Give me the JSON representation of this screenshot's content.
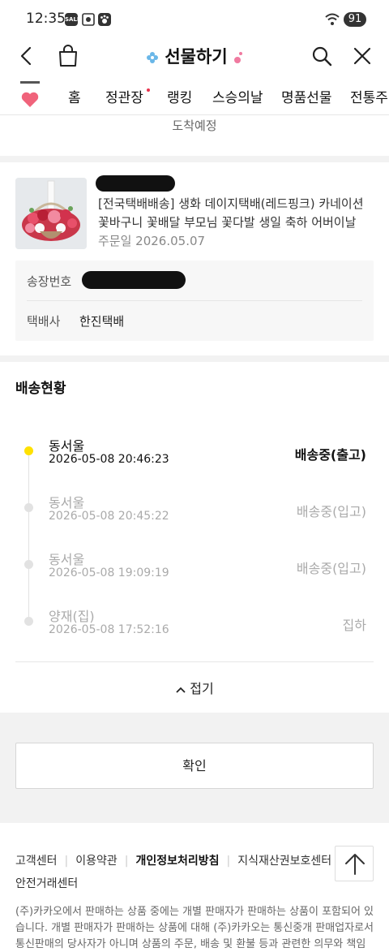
{
  "status_bar": {
    "time": "12:35",
    "battery": "91",
    "badges": [
      "SALE"
    ]
  },
  "header": {
    "title": "선물하기"
  },
  "tabs": [
    {
      "label": "홈"
    },
    {
      "label": "정관장",
      "has_dot": true
    },
    {
      "label": "랭킹"
    },
    {
      "label": "스승의날"
    },
    {
      "label": "명품선물"
    },
    {
      "label": "전통주"
    }
  ],
  "delivery_estimate_label": "도착예정",
  "order": {
    "product_name": "[전국택배배송] 생화 데이지택배(레드핑크) 카네이션 꽃바구니 꽃배달 부모님 꽃다발 생일 축하 어버이날",
    "order_date": "주문일 2026.05.07"
  },
  "shipping_info": {
    "tracking_label": "송장번호",
    "carrier_label": "택배사",
    "carrier_value": "한진택배"
  },
  "tracking": {
    "section_title": "배송현황",
    "events": [
      {
        "place": "동서울",
        "time": "2026-05-08 20:46:23",
        "status": "배송중(출고)",
        "active": true
      },
      {
        "place": "동서울",
        "time": "2026-05-08 20:45:22",
        "status": "배송중(입고)",
        "active": false
      },
      {
        "place": "동서울",
        "time": "2026-05-08 19:09:19",
        "status": "배송중(입고)",
        "active": false
      },
      {
        "place": "양재(집)",
        "time": "2026-05-08 17:52:16",
        "status": "집하",
        "active": false
      }
    ],
    "collapse_label": "접기"
  },
  "confirm_label": "확인",
  "footer": {
    "links": [
      "고객센터",
      "이용약관",
      "개인정보처리방침",
      "지식재산권보호센터"
    ],
    "second_link": "안전거래센터",
    "notice": "(주)카카오에서 판매하는 상품 중에는 개별 판매자가 판매하는 상품이 포함되어 있습니다. 개별 판매자가 판매하는 상품에 대해 (주)카카오는 통신중개 판매업자로서 통신판매의 당사자가 아니며 상품의 주문, 배송 및 환불 등과 관련한 의무와 책임은"
  },
  "colors": {
    "accent_yellow": "#ffe100",
    "tab_dot": "#e8344e",
    "title_deco_blue": "#6ab7e8",
    "title_deco_pink": "#f07aa0"
  }
}
